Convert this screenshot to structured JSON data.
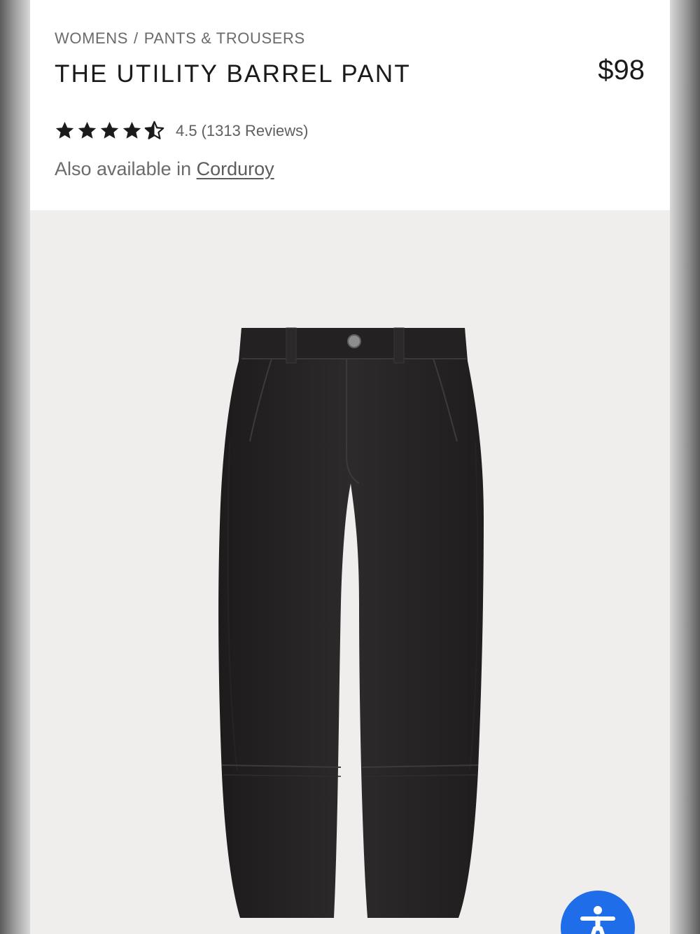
{
  "breadcrumb": {
    "items": [
      "WOMENS",
      "PANTS & TROUSERS"
    ],
    "separator": "/"
  },
  "product": {
    "title": "THE UTILITY BARREL PANT",
    "price": "$98",
    "rating": {
      "value": "4.5",
      "reviews": "(1313 Reviews)",
      "stars_filled": 4.5,
      "stars_total": 5
    },
    "also_available_text": "Also available in",
    "also_available_link": "Corduroy",
    "image_icon": "product-photo-barrel-pant",
    "garment_color": "#2b2829"
  },
  "accessibility_button": {
    "icon": "accessibility-person-icon",
    "color": "#1f6de8"
  }
}
